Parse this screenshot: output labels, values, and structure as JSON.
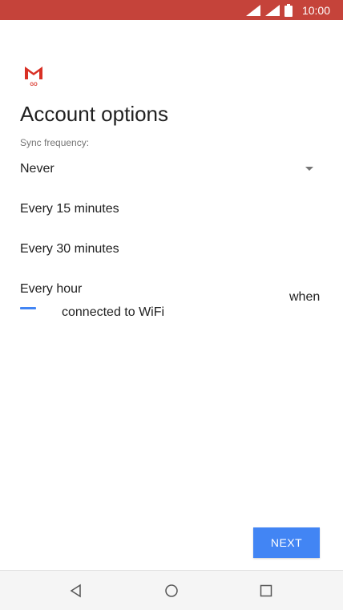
{
  "status_bar": {
    "time": "10:00",
    "background": "#c5433a"
  },
  "app": {
    "logo_text": "GO",
    "logo_icon": "gmail-go-logo"
  },
  "page": {
    "title": "Account options",
    "sync_label": "Sync frequency:",
    "selected_value": "Never"
  },
  "dropdown": {
    "options": [
      "Every 15 minutes",
      "Every 30 minutes",
      "Every hour"
    ]
  },
  "background_text": {
    "when": "when",
    "wifi": "connected to WiFi"
  },
  "actions": {
    "next_label": "NEXT",
    "accent": "#4285f4"
  },
  "nav": {
    "icons": [
      "back-icon",
      "home-icon",
      "recents-icon"
    ]
  }
}
